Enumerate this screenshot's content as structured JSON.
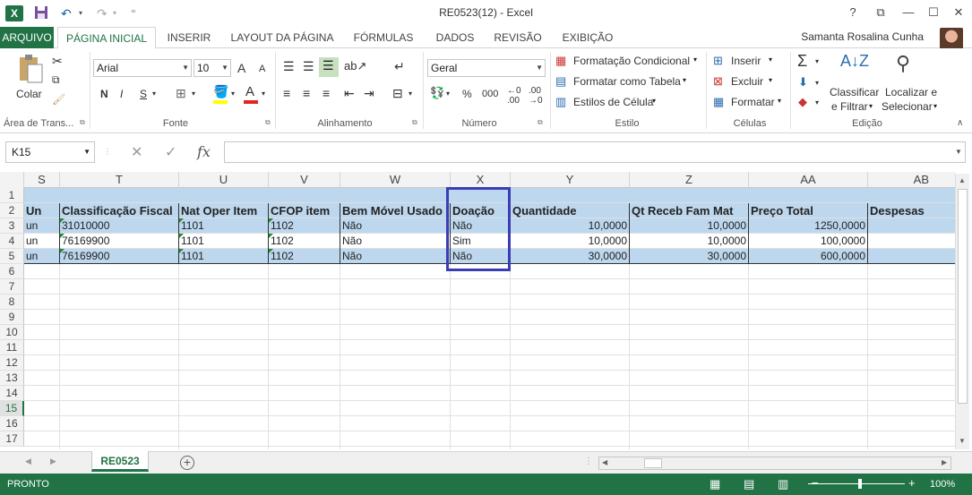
{
  "window": {
    "title": "RE0523(12) - Excel",
    "app_icon": "X",
    "help": "?",
    "min": "—",
    "restore": "☐",
    "close": "✕",
    "ribbon_display": "⧉"
  },
  "quick_access": {
    "save": "💾",
    "undo": "↶",
    "redo": "↷",
    "more": "⁼"
  },
  "tabs": {
    "file": "ARQUIVO",
    "items": [
      "PÁGINA INICIAL",
      "INSERIR",
      "LAYOUT DA PÁGINA",
      "FÓRMULAS",
      "DADOS",
      "REVISÃO",
      "EXIBIÇÃO"
    ],
    "active": "PÁGINA INICIAL"
  },
  "user": {
    "name": "Samanta Rosalina Cunha"
  },
  "ribbon": {
    "clipboard": {
      "label": "Área de Trans...",
      "paste": "Colar"
    },
    "font": {
      "label": "Fonte",
      "family": "Arial",
      "size": "10",
      "bold": "N",
      "italic": "I",
      "underline": "S",
      "grow": "A",
      "shrink": "A"
    },
    "alignment": {
      "label": "Alinhamento"
    },
    "number": {
      "label": "Número",
      "format": "Geral",
      "percent": "%",
      "thousands": "000"
    },
    "styles": {
      "label": "Estilo",
      "conditional": "Formatação Condicional",
      "as_table": "Formatar como Tabela",
      "cell_styles": "Estilos de Célula"
    },
    "cells": {
      "label": "Células",
      "insert": "Inserir",
      "delete": "Excluir",
      "format": "Formatar"
    },
    "editing": {
      "label": "Edição",
      "sort_filter_1": "Classificar",
      "sort_filter_2": "e Filtrar",
      "find_1": "Localizar e",
      "find_2": "Selecionar"
    }
  },
  "formula_bar": {
    "name_box": "K15",
    "fx": "fx",
    "cancel": "✕",
    "enter": "✓",
    "value": ""
  },
  "grid": {
    "columns": [
      "S",
      "T",
      "U",
      "V",
      "W",
      "X",
      "Y",
      "Z",
      "AA",
      "AB"
    ],
    "row_numbers": [
      "1",
      "2",
      "3",
      "4",
      "5",
      "6",
      "7",
      "8",
      "9",
      "10",
      "11",
      "12",
      "13",
      "14",
      "15",
      "16",
      "17"
    ],
    "selected_row": "15",
    "header_row": [
      "Un",
      "Classificação Fiscal",
      "Nat Oper Item",
      "CFOP item",
      "Bem Móvel Usado",
      "Doação",
      "Quantidade",
      "Qt Receb Fam Mat",
      "Preço Total",
      "Despesas"
    ],
    "data_rows": [
      [
        "un",
        "31010000",
        "1101",
        "1102",
        "Não",
        "Não",
        "10,0000",
        "10,0000",
        "1250,0000",
        ""
      ],
      [
        "un",
        "76169900",
        "1101",
        "1102",
        "Não",
        "Sim",
        "10,0000",
        "10,0000",
        "100,0000",
        ""
      ],
      [
        "un",
        "76169900",
        "1101",
        "1102",
        "Não",
        "Não",
        "30,0000",
        "30,0000",
        "600,0000",
        ""
      ]
    ]
  },
  "sheets": {
    "active": "RE0523",
    "add": "+"
  },
  "status": {
    "text": "PRONTO",
    "zoom": "100%"
  },
  "colors": {
    "accent": "#217346",
    "band": "#bdd7ee",
    "highlight_box": "#3b3db5"
  }
}
